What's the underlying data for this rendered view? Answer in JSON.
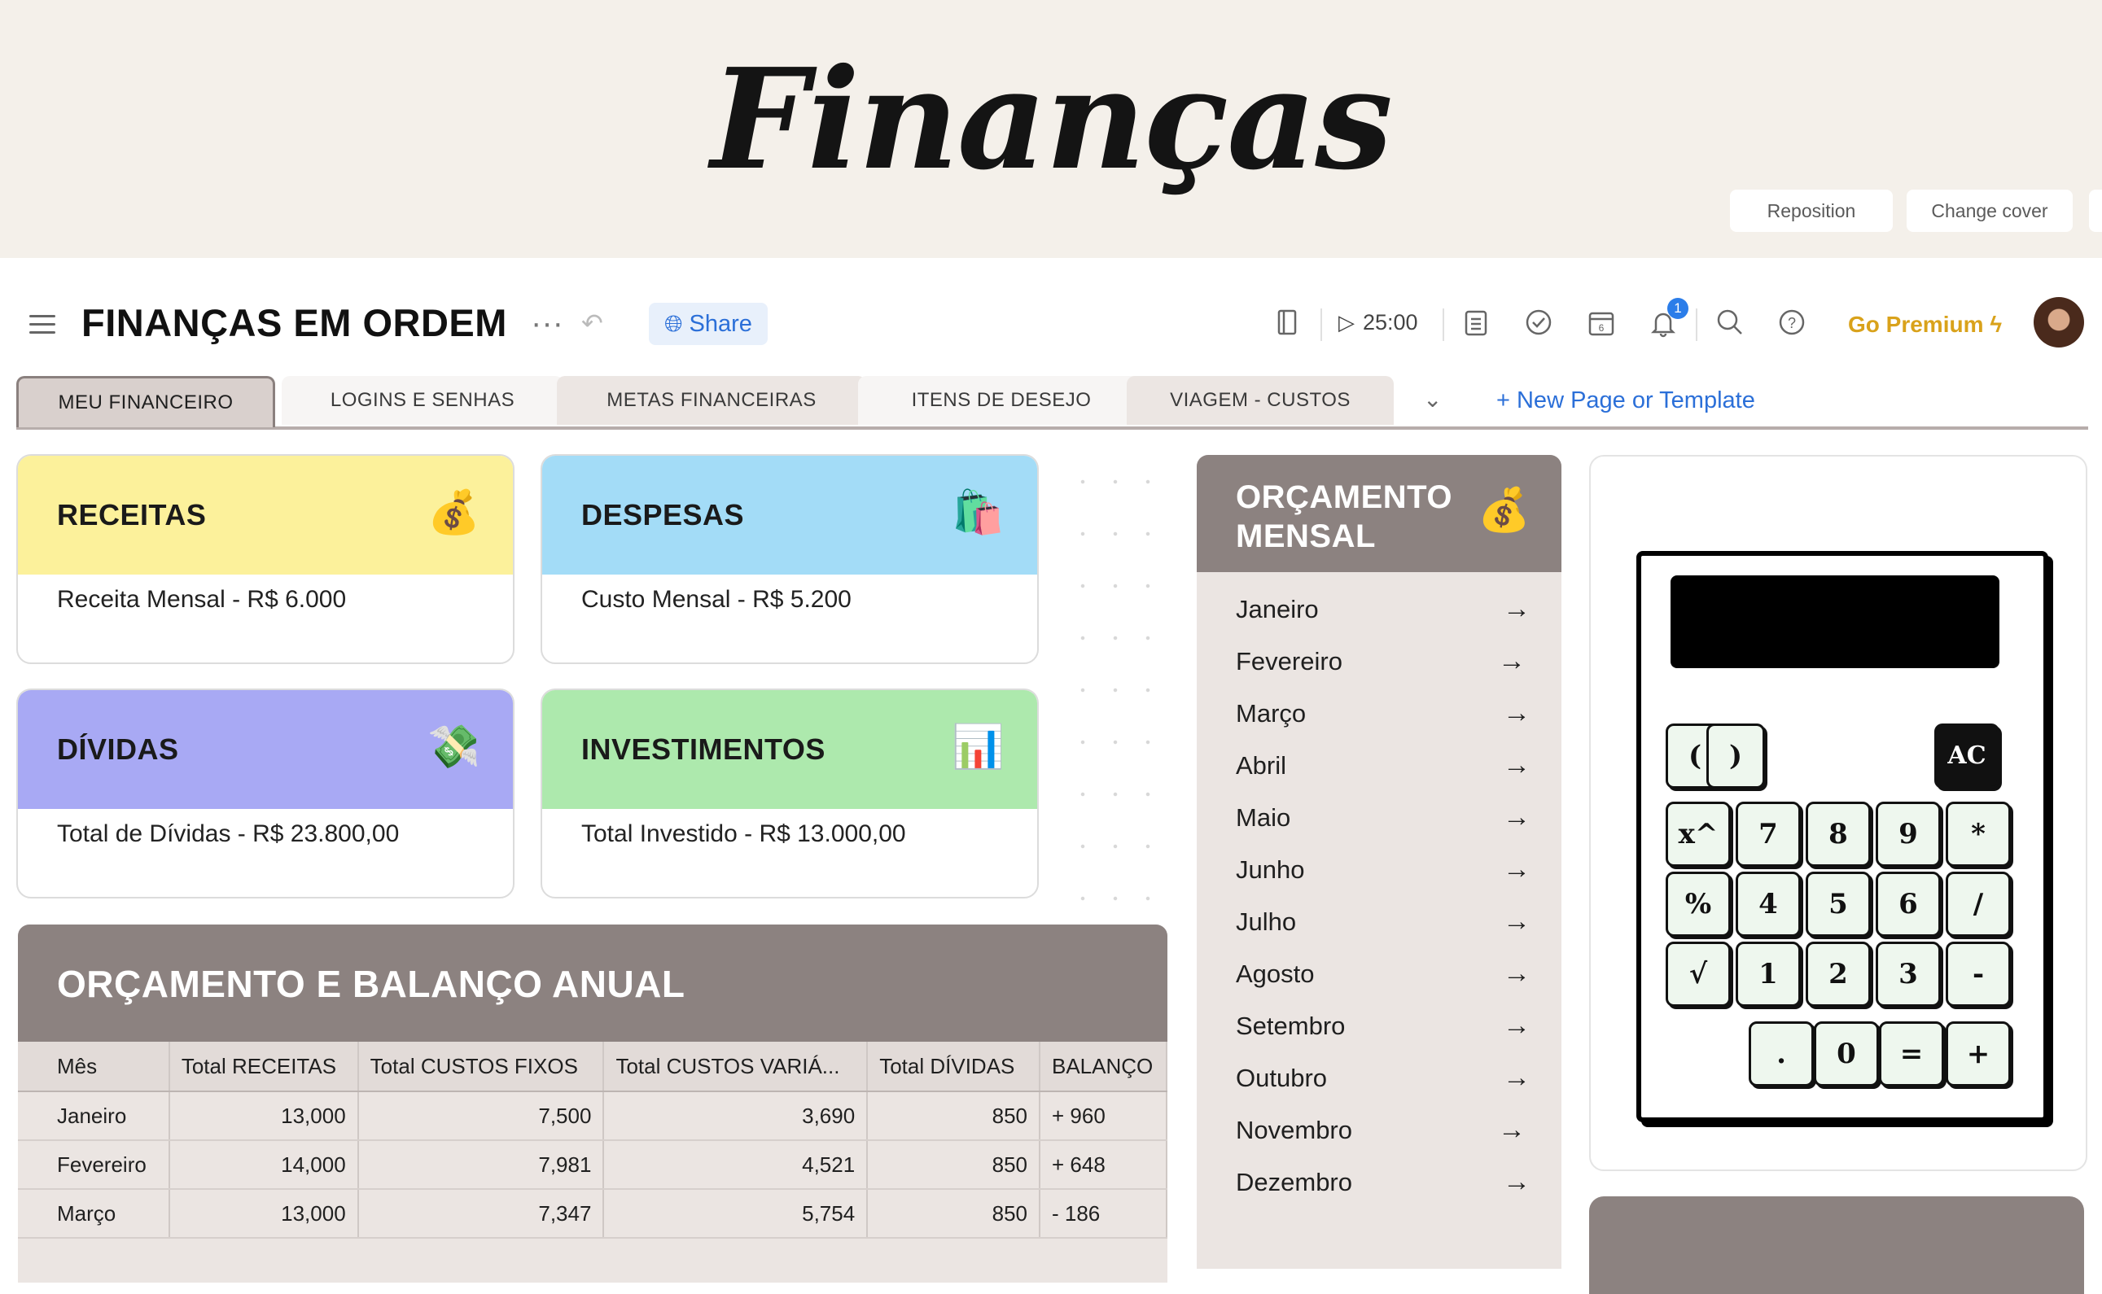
{
  "cover": {
    "title": "Finanças",
    "reposition_label": "Reposition",
    "change_cover_label": "Change cover"
  },
  "header": {
    "title": "FINANÇAS EM ORDEM",
    "share_label": "Share",
    "timer": "25:00",
    "notification_count": "1",
    "premium_label": "Go Premium"
  },
  "tabs": [
    "MEU FINANCEIRO",
    "LOGINS E SENHAS",
    "METAS FINANCEIRAS",
    "ITENS DE DESEJO",
    "VIAGEM - CUSTOS"
  ],
  "new_page_label": "+ New Page or Template",
  "cards": {
    "receitas": {
      "title": "RECEITAS",
      "emoji": "💰",
      "text": "Receita Mensal - R$ 6.000",
      "color": "#fcf19b"
    },
    "despesas": {
      "title": "DESPESAS",
      "emoji": "🛍️",
      "text": "Custo Mensal - R$ 5.200",
      "color": "#a3dcf7"
    },
    "dividas": {
      "title": "DÍVIDAS",
      "emoji": "💸",
      "text": "Total de Dívidas - R$ 23.800,00",
      "color": "#a8a9f4"
    },
    "investimentos": {
      "title": "INVESTIMENTOS",
      "emoji": "📊",
      "text": "Total Investido - R$ 13.000,00",
      "color": "#ade9ad"
    }
  },
  "budget": {
    "title": "ORÇAMENTO MENSAL",
    "emoji": "💰",
    "months": [
      "Janeiro",
      "Fevereiro",
      "Março",
      "Abril",
      "Maio",
      "Junho",
      "Julho",
      "Agosto",
      "Setembro",
      "Outubro",
      "Novembro",
      "Dezembro"
    ],
    "arrow": "→"
  },
  "calculator": {
    "keys": [
      "(",
      ")",
      "AC",
      "x^",
      "7",
      "8",
      "9",
      "*",
      "%",
      "4",
      "5",
      "6",
      "/",
      "√",
      "1",
      "2",
      "3",
      "-",
      ".",
      "0",
      "=",
      "+"
    ]
  },
  "annual": {
    "title": "ORÇAMENTO E BALANÇO ANUAL",
    "columns": [
      "Mês",
      "Total RECEITAS",
      "Total CUSTOS FIXOS",
      "Total CUSTOS VARIÁ...",
      "Total DÍVIDAS",
      "BALANÇO"
    ],
    "rows": [
      [
        "Janeiro",
        "13,000",
        "7,500",
        "3,690",
        "850",
        "+ 960"
      ],
      [
        "Fevereiro",
        "14,000",
        "7,981",
        "4,521",
        "850",
        "+ 648"
      ],
      [
        "Março",
        "13,000",
        "7,347",
        "5,754",
        "850",
        "- 186"
      ]
    ]
  },
  "colors": {
    "accent": "#2b6fd8",
    "panel": "#8c8280",
    "panel_bg": "#ebe5e2",
    "premium": "#d9a21b"
  }
}
